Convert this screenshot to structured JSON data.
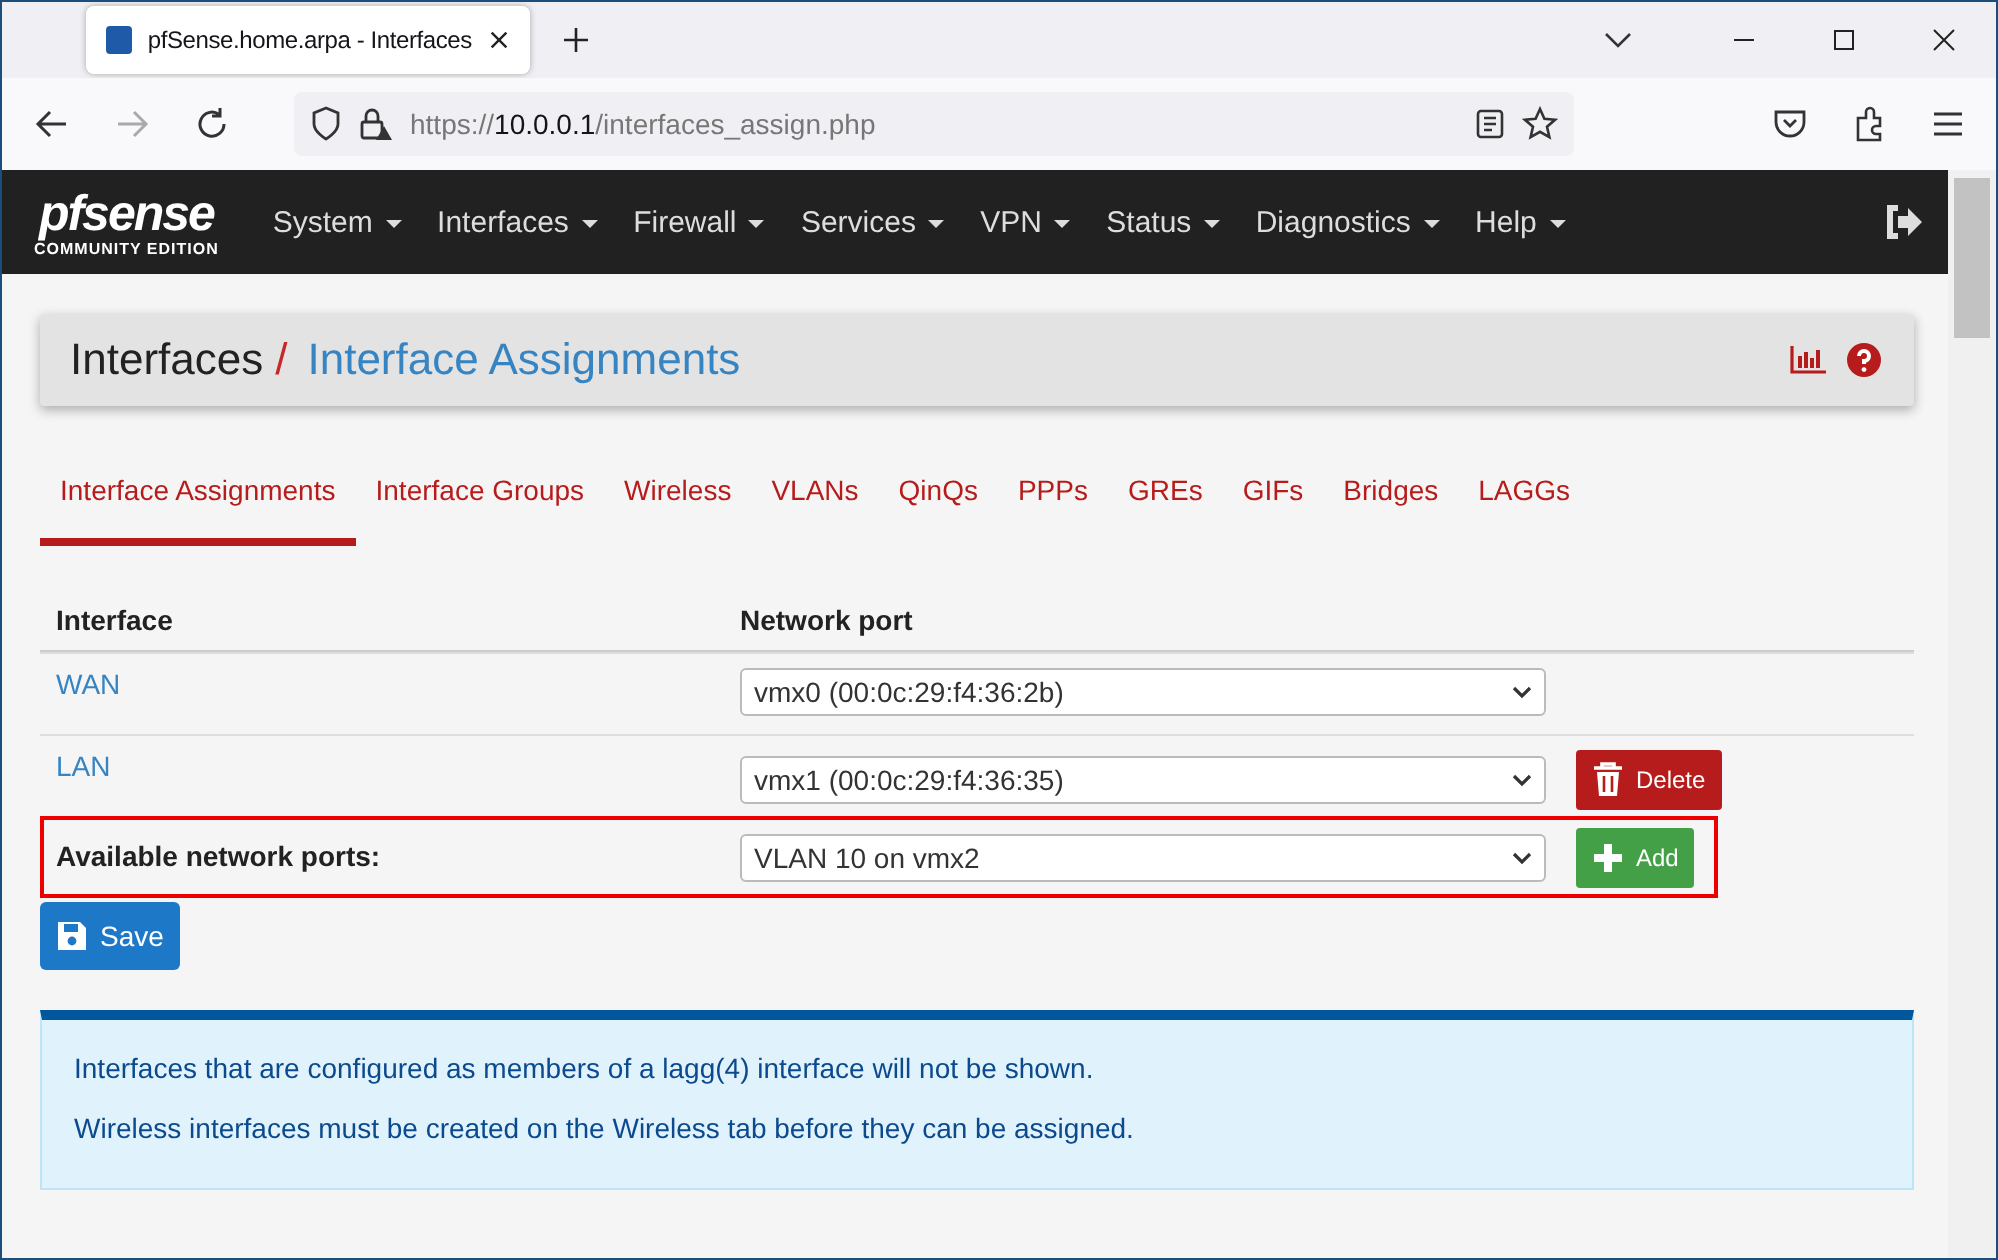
{
  "browser": {
    "tab_title": "pfSense.home.arpa - Interfaces",
    "url_scheme": "https://",
    "url_host": "10.0.0.1",
    "url_path": "/interfaces_assign.php"
  },
  "navbar": {
    "logo_top": "pfsense",
    "logo_bottom": "COMMUNITY EDITION",
    "menus": [
      "System",
      "Interfaces",
      "Firewall",
      "Services",
      "VPN",
      "Status",
      "Diagnostics",
      "Help"
    ]
  },
  "breadcrumb": {
    "parent": "Interfaces",
    "separator": "/",
    "current": "Interface Assignments"
  },
  "tabs": [
    {
      "label": "Interface Assignments",
      "selected": true
    },
    {
      "label": "Interface Groups",
      "selected": false
    },
    {
      "label": "Wireless",
      "selected": false
    },
    {
      "label": "VLANs",
      "selected": false
    },
    {
      "label": "QinQs",
      "selected": false
    },
    {
      "label": "PPPs",
      "selected": false
    },
    {
      "label": "GREs",
      "selected": false
    },
    {
      "label": "GIFs",
      "selected": false
    },
    {
      "label": "Bridges",
      "selected": false
    },
    {
      "label": "LAGGs",
      "selected": false
    }
  ],
  "table": {
    "columns": [
      "Interface",
      "Network port"
    ],
    "rows": [
      {
        "kind": "assigned",
        "name": "WAN",
        "port": "vmx0 (00:0c:29:f4:36:2b)",
        "highlighted": false
      },
      {
        "kind": "assigned",
        "name": "LAN",
        "port": "vmx1 (00:0c:29:f4:36:35)",
        "action": "Delete",
        "highlighted": false
      },
      {
        "kind": "available",
        "name": "Available network ports:",
        "port": "VLAN 10 on vmx2",
        "action": "Add",
        "highlighted": true
      }
    ]
  },
  "save_button": "Save",
  "info": [
    "Interfaces that are configured as members of a lagg(4) interface will not be shown.",
    "Wireless interfaces must be created on the Wireless tab before they can be assigned."
  ]
}
